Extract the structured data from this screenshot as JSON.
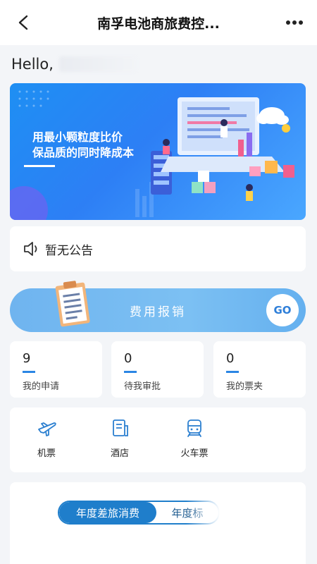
{
  "header": {
    "title": "南孚电池商旅费控...",
    "back_icon": "chevron-left-icon",
    "more_icon": "more-dots-icon"
  },
  "greeting": {
    "text": "Hello,"
  },
  "banner": {
    "line1": "用最小颗粒度比价",
    "line2": "保品质的同时降成本"
  },
  "notice": {
    "icon": "speaker-icon",
    "text": "暂无公告"
  },
  "expense": {
    "label": "费用报销",
    "go_label": "GO"
  },
  "stats": [
    {
      "value": "9",
      "label": "我的申请"
    },
    {
      "value": "0",
      "label": "待我审批"
    },
    {
      "value": "0",
      "label": "我的票夹"
    }
  ],
  "quick_entries": [
    {
      "icon": "plane-icon",
      "label": "机票"
    },
    {
      "icon": "hotel-icon",
      "label": "酒店"
    },
    {
      "icon": "train-icon",
      "label": "火车票"
    }
  ],
  "annual": {
    "tabs": [
      {
        "label": "年度差旅消费",
        "active": true
      },
      {
        "label": "年度标",
        "active": false
      }
    ]
  },
  "colors": {
    "accent": "#1f7ecb",
    "banner": "#2d7ff5",
    "expense_button": "#74b9f1",
    "background": "#f3f5f8"
  }
}
